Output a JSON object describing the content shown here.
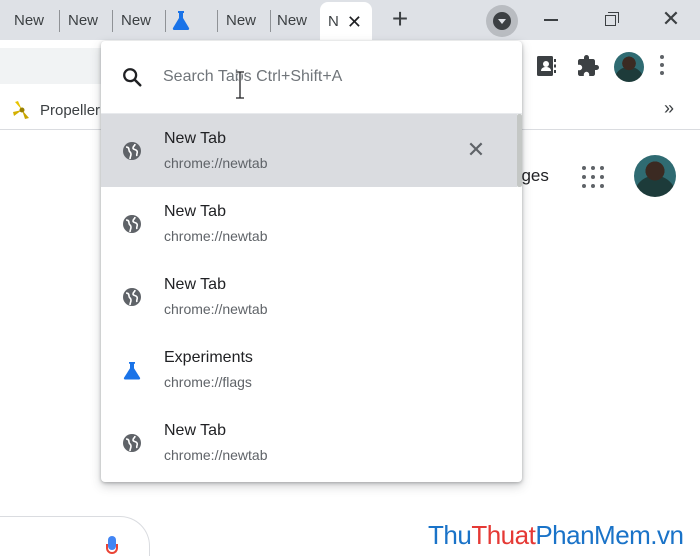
{
  "tabstrip": {
    "tabs": [
      {
        "label": "New"
      },
      {
        "label": "New"
      },
      {
        "label": "New"
      },
      {
        "label": "",
        "icon": "flask-icon"
      },
      {
        "label": "New"
      },
      {
        "label": "New"
      }
    ],
    "active_tab": {
      "label": "N"
    },
    "new_tab_symbol": "+",
    "tab_search_icon": "chevron-down-circle-icon"
  },
  "toolbar": {
    "icons": [
      "reading-list-icon",
      "extensions-puzzle-icon",
      "profile-avatar",
      "kebab-menu-icon"
    ]
  },
  "bookmarks": {
    "items": [
      {
        "label": "Propeller",
        "icon": "propeller-icon"
      }
    ],
    "overflow": "»"
  },
  "ntp": {
    "images_link": "ages",
    "apps_icon": "apps-grid-icon"
  },
  "tab_search": {
    "placeholder": "Search Tabs Ctrl+Shift+A",
    "results": [
      {
        "title": "New Tab",
        "url": "chrome://newtab",
        "icon": "globe-icon",
        "selected": true
      },
      {
        "title": "New Tab",
        "url": "chrome://newtab",
        "icon": "globe-icon",
        "selected": false
      },
      {
        "title": "New Tab",
        "url": "chrome://newtab",
        "icon": "globe-icon",
        "selected": false
      },
      {
        "title": "Experiments",
        "url": "chrome://flags",
        "icon": "flask-icon",
        "selected": false
      },
      {
        "title": "New Tab",
        "url": "chrome://newtab",
        "icon": "globe-icon",
        "selected": false
      }
    ],
    "close_symbol": "✕"
  },
  "watermark": {
    "part1": "Thu",
    "part2": "Thuat",
    "part3": "PhanMem.vn"
  },
  "colors": {
    "tabstrip_bg": "#dee1e6",
    "selected_row": "#dadce0",
    "flask_blue": "#1a73e8"
  }
}
